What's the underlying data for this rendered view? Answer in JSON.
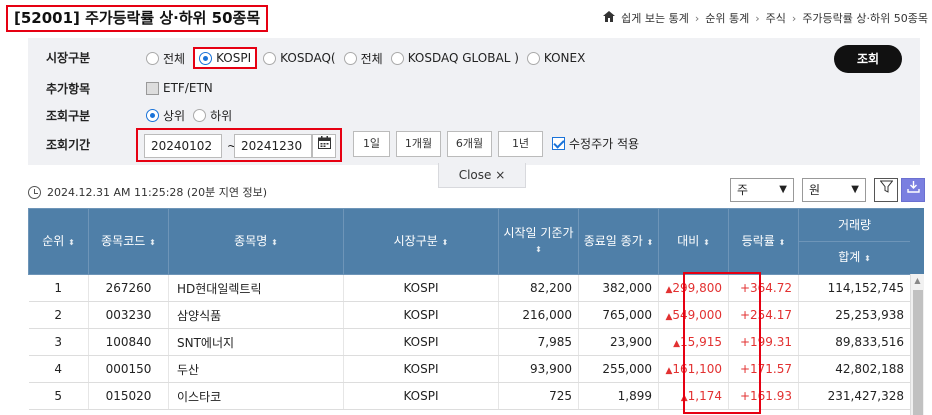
{
  "header": {
    "title": "[52001] 주가등락률 상·하위 50종목",
    "breadcrumb": [
      "쉽게 보는 통계",
      "순위 통계",
      "주식",
      "주가등락률 상·하위 50종목"
    ]
  },
  "filter": {
    "market_label": "시장구분",
    "market_options": [
      "전체",
      "KOSPI",
      "KOSDAQ(",
      "전체",
      "KOSDAQ GLOBAL )",
      "KONEX"
    ],
    "extra_label": "추가항목",
    "extra_option": "ETF/ETN",
    "query_label": "조회구분",
    "query_options": [
      "상위",
      "하위"
    ],
    "period_label": "조회기간",
    "start_date": "20240102",
    "tilde": "~",
    "end_date": "20241230",
    "period_buttons": [
      "1일",
      "1개월",
      "6개월",
      "1년"
    ],
    "adjusted_label": "수정주가 적용",
    "search_button": "조회",
    "close_label": "Close ×"
  },
  "info": {
    "timestamp": "2024.12.31 AM 11:25:28 (20분 지연 정보)",
    "unit_select": "주",
    "currency_select": "원"
  },
  "table": {
    "headers": [
      "순위",
      "종목코드",
      "종목명",
      "시장구분",
      "시작일 기준가",
      "종료일 종가",
      "대비",
      "등락률",
      "거래량"
    ],
    "sub_header": "합계",
    "rows": [
      {
        "rank": "1",
        "code": "267260",
        "name": "HD현대일렉트릭",
        "market": "KOSPI",
        "start": "82,200",
        "end": "382,000",
        "change": "299,800",
        "rate": "+364.72",
        "volume": "114,152,745"
      },
      {
        "rank": "2",
        "code": "003230",
        "name": "삼양식품",
        "market": "KOSPI",
        "start": "216,000",
        "end": "765,000",
        "change": "549,000",
        "rate": "+254.17",
        "volume": "25,253,938"
      },
      {
        "rank": "3",
        "code": "100840",
        "name": "SNT에너지",
        "market": "KOSPI",
        "start": "7,985",
        "end": "23,900",
        "change": "15,915",
        "rate": "+199.31",
        "volume": "89,833,516"
      },
      {
        "rank": "4",
        "code": "000150",
        "name": "두산",
        "market": "KOSPI",
        "start": "93,900",
        "end": "255,000",
        "change": "161,100",
        "rate": "+171.57",
        "volume": "42,802,188"
      },
      {
        "rank": "5",
        "code": "015020",
        "name": "이스타코",
        "market": "KOSPI",
        "start": "725",
        "end": "1,899",
        "change": "1,174",
        "rate": "+161.93",
        "volume": "231,427,328"
      }
    ]
  },
  "icons": {
    "home": "home-icon",
    "calendar": "calendar-icon",
    "clock": "clock-icon",
    "filter": "filter-icon",
    "download": "download-icon"
  },
  "colors": {
    "header_bg": "#4f7fa8",
    "rise": "#e23131",
    "highlight": "#e60012",
    "accent": "#1a73d9"
  }
}
